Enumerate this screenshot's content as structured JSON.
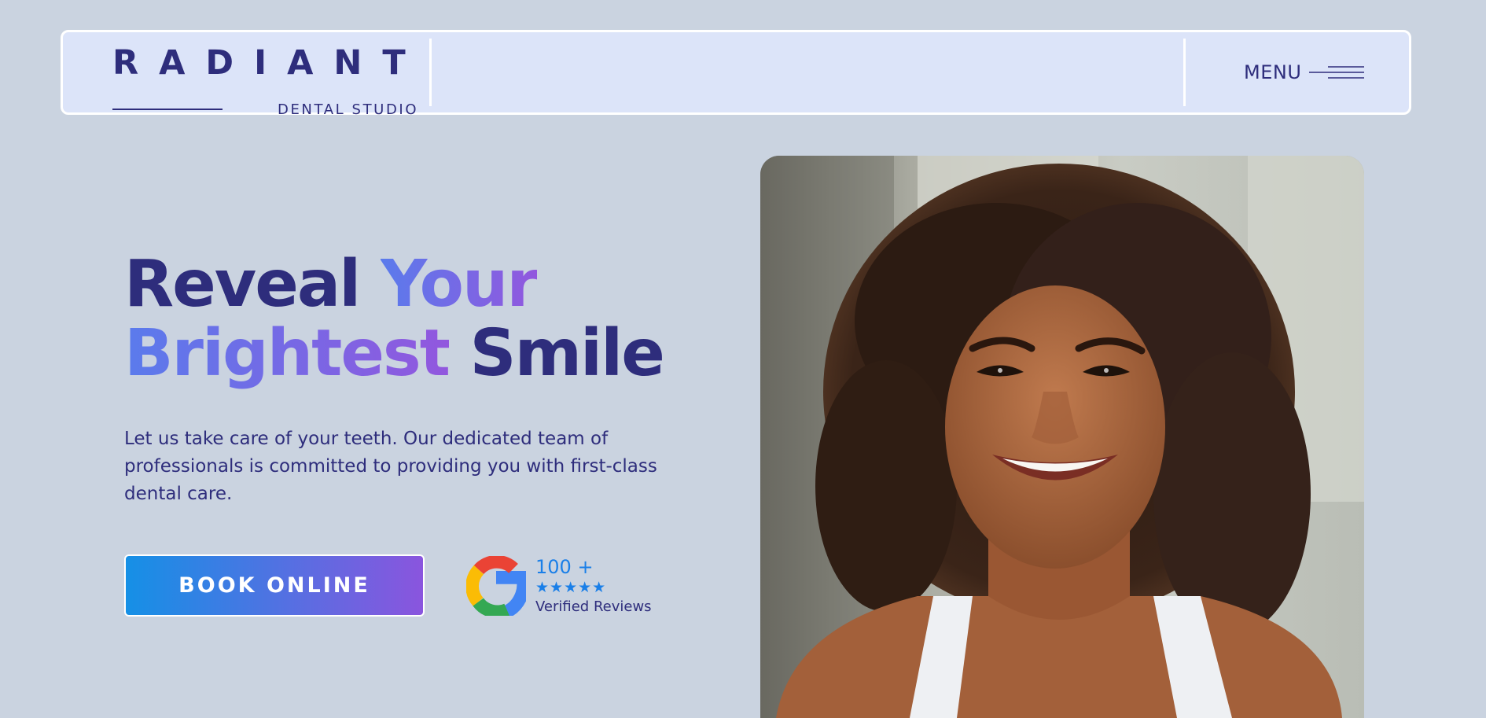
{
  "brand": {
    "name": "RADIANT",
    "subtitle": "DENTAL STUDIO"
  },
  "nav": {
    "menu_label": "MENU",
    "menu_icon": "hamburger-icon"
  },
  "hero": {
    "headline": {
      "w1": "Reveal",
      "w2": "Your",
      "w3": "Brightest",
      "w4": "Smile"
    },
    "intro": "Let us take care of your teeth. Our dedicated team of professionals is committed to providing you with first-class dental care.",
    "cta_label": "BOOK ONLINE",
    "photo_icon": "smiling-woman-photo"
  },
  "reviews": {
    "icon": "google-icon",
    "count": "100 +",
    "stars": "★★★★★",
    "rating": 5,
    "label": "Verified Reviews"
  },
  "colors": {
    "background": "#cad3e0",
    "header_bg": "#dce4f9",
    "navy": "#2e2d7c",
    "gradient_start": "#5a7bec",
    "gradient_end": "#9257de",
    "button_start": "#1590e6",
    "button_end": "#8a55de",
    "accent_blue": "#1a7fe8"
  }
}
